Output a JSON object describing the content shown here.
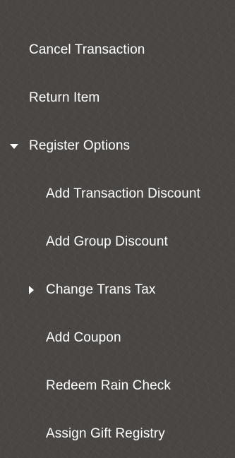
{
  "menu": {
    "items": [
      {
        "label": "Cancel Transaction"
      },
      {
        "label": "Return Item"
      },
      {
        "label": "Register Options",
        "expanded": true,
        "icon": "caret-down-icon"
      },
      {
        "label": "Add Transaction Discount"
      },
      {
        "label": "Add Group Discount"
      },
      {
        "label": "Change Trans Tax",
        "expanded": false,
        "icon": "caret-right-icon"
      },
      {
        "label": "Add Coupon"
      },
      {
        "label": "Redeem Rain Check"
      },
      {
        "label": "Assign Gift Registry"
      }
    ]
  },
  "colors": {
    "background": "#4a4643",
    "text": "#ffffff"
  }
}
